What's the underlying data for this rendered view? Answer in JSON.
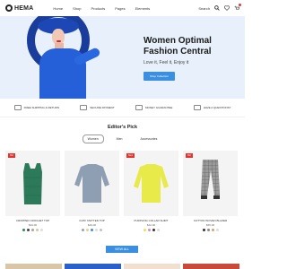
{
  "brand": {
    "logo_text": "HEMA"
  },
  "nav": {
    "items": [
      "Home",
      "Shop",
      "Products",
      "Pages",
      "Elements"
    ]
  },
  "header_right": {
    "search_label": "Search",
    "cart_count": ""
  },
  "hero": {
    "title": "Women Optimal Fashion Central",
    "subtitle": "Love it, Feel it, Enjoy it",
    "button_label": "Shop Collection"
  },
  "features": [
    {
      "label": "FREE SHIPPING & RETURN",
      "icon": "truck-icon"
    },
    {
      "label": "SECURE PAYMENT",
      "icon": "card-icon"
    },
    {
      "label": "MONEY GUARANTEE",
      "icon": "money-icon"
    },
    {
      "label": "HAVE A QUESTIONS?",
      "icon": "question-icon"
    }
  ],
  "editors_pick": {
    "title": "Editor's Pick",
    "tabs": [
      "Women",
      "Men",
      "Accessories"
    ],
    "active_tab": "Women"
  },
  "products": [
    {
      "name": "CROPPED CROCHET TOP",
      "price": "$34.00",
      "badge": "Hot",
      "colors": [
        "#2d8a4e",
        "#444",
        "#a3a3a3",
        "#d9c3a0",
        "#ddd"
      ]
    },
    {
      "name": "CUFF KNITTED TOP",
      "price": "$29.00",
      "badge": "",
      "colors": [
        "#8fa3c0",
        "#e8d28a",
        "#3b8fe0",
        "#ddd",
        "#c2c2c2"
      ]
    },
    {
      "name": "PURPLING COLLAR SHIRT",
      "price": "$42.00",
      "badge": "New",
      "colors": [
        "#e0e84a",
        "#d58fbf",
        "#333",
        "#ddd"
      ]
    },
    {
      "name": "COTTON WOVEN BLAZER",
      "price": "$55.00",
      "badge": "Hot",
      "colors": [
        "#333",
        "#8a8a8a",
        "#c9a56e",
        "#ddd"
      ]
    }
  ],
  "view_all_label": "VIEW ALL",
  "colors": {
    "accent": "#3b8fe0",
    "badge": "#e3342f",
    "hero_bg": "#e8f1fb"
  }
}
